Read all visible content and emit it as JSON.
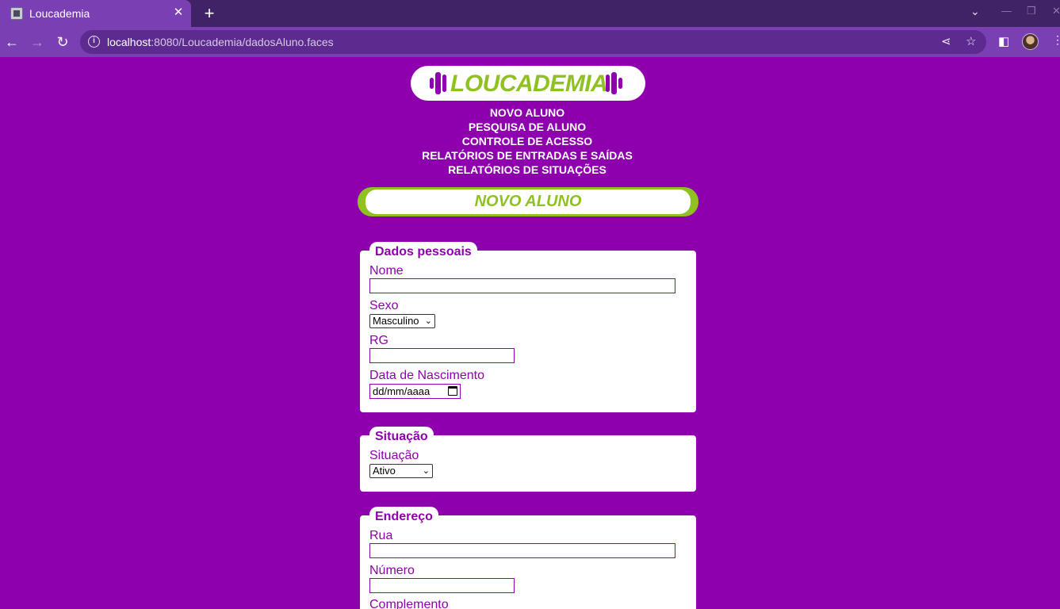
{
  "browser": {
    "tab_title": "Loucademia",
    "tab_close": "✕",
    "new_tab": "+",
    "url_host": "localhost",
    "url_rest": ":8080/Loucademia/dadosAluno.faces"
  },
  "header": {
    "logo_text": "LOUCADEMIA",
    "menu": [
      "NOVO ALUNO",
      "PESQUISA DE ALUNO",
      "CONTROLE DE ACESSO",
      "RELATÓRIOS DE ENTRADAS E SAÍDAS",
      "RELATÓRIOS DE SITUAÇÕES"
    ],
    "page_title": "NOVO ALUNO"
  },
  "dados_pessoais": {
    "legend": "Dados pessoais",
    "nome_label": "Nome",
    "nome_value": "",
    "sexo_label": "Sexo",
    "sexo_value": "Masculino",
    "rg_label": "RG",
    "rg_value": "",
    "nascimento_label": "Data de Nascimento",
    "nascimento_placeholder": "dd/mm/aaaa"
  },
  "situacao": {
    "legend": "Situação",
    "label": "Situação",
    "value": "Ativo"
  },
  "endereco": {
    "legend": "Endereço",
    "rua_label": "Rua",
    "rua_value": "",
    "numero_label": "Número",
    "numero_value": "",
    "complemento_label": "Complemento"
  },
  "colors": {
    "page_bg": "#8e00ad",
    "accent_green": "#8fc220",
    "panel_bg": "#ffffff"
  }
}
